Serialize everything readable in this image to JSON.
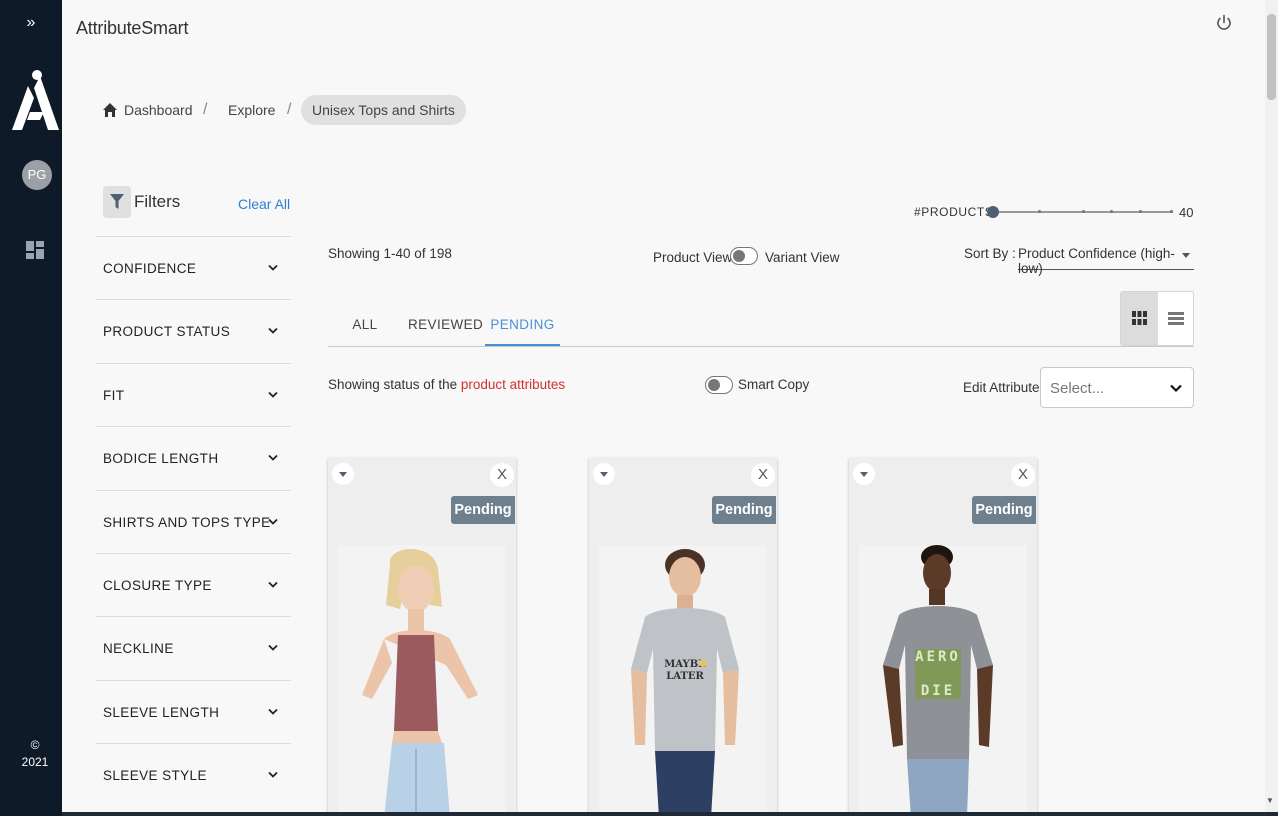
{
  "app": {
    "title": "AttributeSmart"
  },
  "rail": {
    "expand_glyph": "»",
    "avatar_initials": "PG",
    "copyright_symbol": "©",
    "copyright_year": "2021"
  },
  "breadcrumb": [
    {
      "label": "Dashboard",
      "icon": "home-icon"
    },
    {
      "label": "Explore"
    },
    {
      "label": "Unisex Tops and Shirts"
    }
  ],
  "breadcrumb_separator": "/",
  "filters": {
    "title": "Filters",
    "clear_all": "Clear All",
    "items": [
      {
        "label": "CONFIDENCE"
      },
      {
        "label": "PRODUCT STATUS"
      },
      {
        "label": "FIT"
      },
      {
        "label": "BODICE LENGTH"
      },
      {
        "label": "SHIRTS AND TOPS TYPE"
      },
      {
        "label": "CLOSURE TYPE"
      },
      {
        "label": "NECKLINE"
      },
      {
        "label": "SLEEVE LENGTH"
      },
      {
        "label": "SLEEVE STYLE"
      }
    ]
  },
  "products_slider": {
    "label": "#PRODUCTS",
    "value": 40,
    "max_label": "40",
    "level_fraction": 0.0
  },
  "listing": {
    "showing": "Showing  1-40 of 198",
    "product_view_label": "Product View",
    "variant_view_label": "Variant View",
    "sort_label": "Sort By :",
    "sort_value": "Product Confidence (high-low)"
  },
  "tabs": [
    {
      "label": "ALL",
      "active": false
    },
    {
      "label": "REVIEWED",
      "active": false
    },
    {
      "label": "PENDING",
      "active": true
    }
  ],
  "status_bar": {
    "prefix": "Showing status of the ",
    "link": "product attributes",
    "smart_copy_label": "Smart Copy",
    "edit_attribute_label": "Edit Attribute:",
    "edit_attribute_placeholder": "Select..."
  },
  "cards": [
    {
      "status": "Pending",
      "close_glyph": "X",
      "image": "woman-halter-top"
    },
    {
      "status": "Pending",
      "close_glyph": "X",
      "image": "man-grey-tee-maybe-later"
    },
    {
      "status": "Pending",
      "close_glyph": "X",
      "image": "man-grey-tee-aero"
    }
  ],
  "colors": {
    "rail": "#0e1a28",
    "accent": "#4a90d9",
    "badge": "#6e7f8d",
    "link": "#d03030"
  }
}
